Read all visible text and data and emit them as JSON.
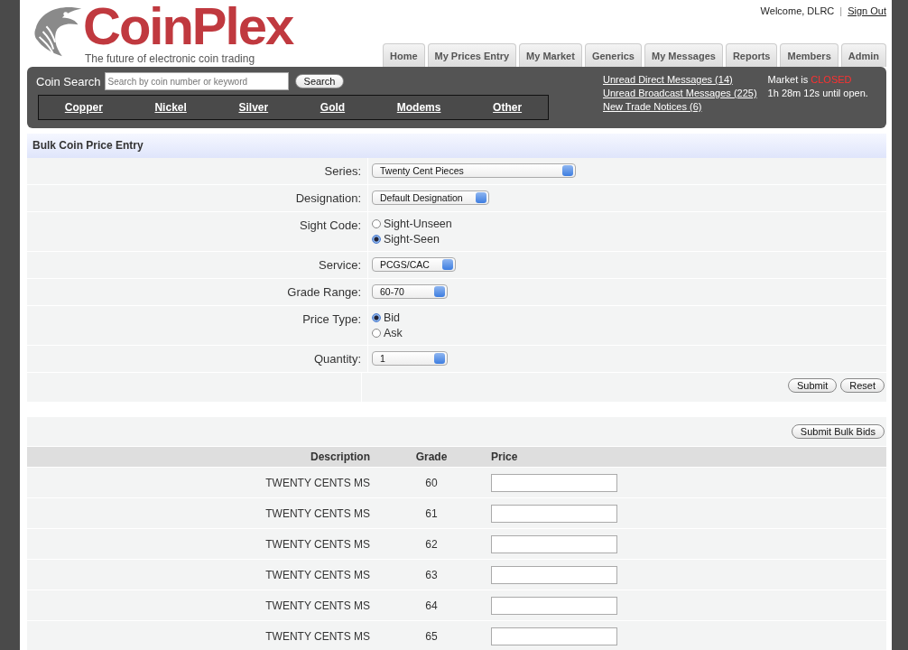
{
  "header": {
    "logo": "CoinPlex",
    "tagline": "The future of electronic coin trading",
    "welcome": "Welcome, DLRC",
    "separator": "|",
    "sign_out": "Sign Out"
  },
  "tabs": [
    {
      "label": "Home",
      "selected": false
    },
    {
      "label": "My Prices Entry",
      "selected": false
    },
    {
      "label": "My Market",
      "selected": false
    },
    {
      "label": "Generics",
      "selected": false
    },
    {
      "label": "My Messages",
      "selected": false
    },
    {
      "label": "Reports",
      "selected": false
    },
    {
      "label": "Members",
      "selected": false
    },
    {
      "label": "Admin",
      "selected": false
    }
  ],
  "search": {
    "label": "Coin Search",
    "placeholder": "Search by coin number or keyword",
    "button": "Search"
  },
  "categories": [
    "Copper",
    "Nickel",
    "Silver",
    "Gold",
    "Modems",
    "Other"
  ],
  "notices": [
    "Unread Direct Messages (14)",
    "Unread Broadcast Messages (225)",
    "New Trade Notices (6)"
  ],
  "market": {
    "label": "Market is",
    "status": "CLOSED",
    "countdown": "1h 28m 12s until open."
  },
  "section_title": "Bulk Coin Price Entry",
  "form": [
    {
      "kind": "select",
      "label": "Series:",
      "value": "Twenty Cent Pieces"
    },
    {
      "kind": "select",
      "label": "Designation:",
      "value": "Default Designation"
    },
    {
      "kind": "radio",
      "label": "Sight Code:",
      "options": [
        {
          "label": "Sight-Unseen",
          "selected": false
        },
        {
          "label": "Sight-Seen",
          "selected": true
        }
      ]
    },
    {
      "kind": "select",
      "label": "Service:",
      "value": "PCGS/CAC"
    },
    {
      "kind": "select",
      "label": "Grade Range:",
      "value": "60-70"
    },
    {
      "kind": "radio",
      "label": "Price Type:",
      "options": [
        {
          "label": "Bid",
          "selected": true
        },
        {
          "label": "Ask",
          "selected": false
        }
      ]
    },
    {
      "kind": "select",
      "label": "Quantity:",
      "value": "1"
    }
  ],
  "form_buttons": [
    "Submit",
    "Reset"
  ],
  "bulk_button": "Submit Bulk Bids",
  "table": {
    "columns": [
      "Description",
      "Grade",
      "Price"
    ],
    "rows": [
      {
        "description": "TWENTY CENTS MS",
        "grade": "60"
      },
      {
        "description": "TWENTY CENTS MS",
        "grade": "61"
      },
      {
        "description": "TWENTY CENTS MS",
        "grade": "62"
      },
      {
        "description": "TWENTY CENTS MS",
        "grade": "63"
      },
      {
        "description": "TWENTY CENTS MS",
        "grade": "64"
      },
      {
        "description": "TWENTY CENTS MS",
        "grade": "65"
      }
    ]
  }
}
